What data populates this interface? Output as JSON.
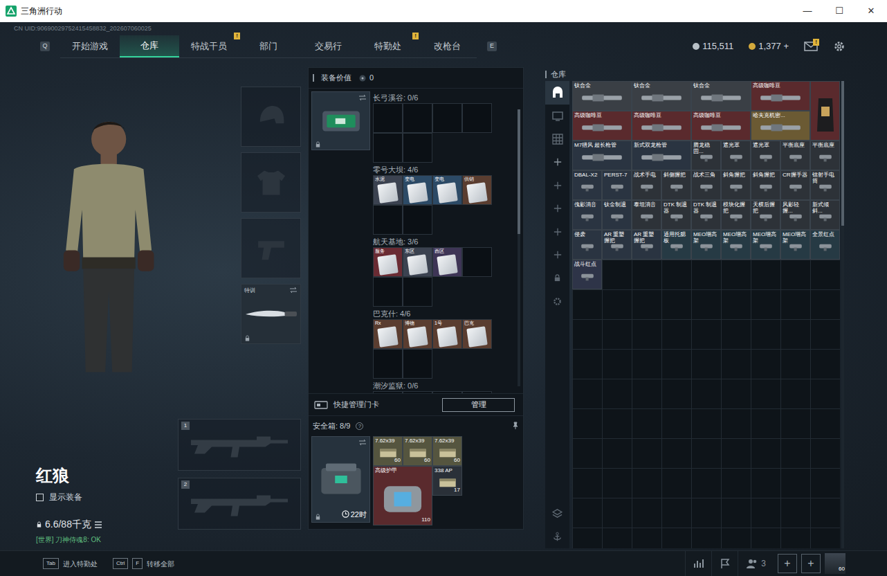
{
  "window": {
    "title": "三角洲行动",
    "controls": [
      "—",
      "☐",
      "✕"
    ]
  },
  "uid": "CN UID:90690029752415458832_202607060025",
  "nav": {
    "prev_key": "Q",
    "next_key": "E",
    "tabs": [
      {
        "label": "开始游戏",
        "selected": false
      },
      {
        "label": "仓库",
        "selected": true
      },
      {
        "label": "特战干员",
        "selected": false,
        "badge": "!"
      },
      {
        "label": "部门",
        "selected": false
      },
      {
        "label": "交易行",
        "selected": false
      },
      {
        "label": "特勤处",
        "selected": false,
        "badge": "!"
      },
      {
        "label": "改枪台",
        "selected": false
      }
    ]
  },
  "currency": [
    {
      "value": "115,511",
      "kind": "silver"
    },
    {
      "value": "1,377 +",
      "kind": "gold"
    }
  ],
  "mail": {
    "badge": "!"
  },
  "gear_slots": [
    {
      "kind": "helmet"
    },
    {
      "kind": "armor"
    },
    {
      "kind": "pistol"
    },
    {
      "kind": "melee",
      "label": "特训"
    }
  ],
  "weapon_slots": [
    "1",
    "2"
  ],
  "character": {
    "name": "红狼",
    "show_equipment": {
      "label": "显示装备",
      "checked": false
    },
    "weight": "6.6/88千克",
    "chat": "[世界] 刀神侍魂8: OK"
  },
  "equipment_value": {
    "label": "装备价值",
    "value": "0"
  },
  "keycards": {
    "scrollbar": {
      "level": 0.45
    },
    "sections": [
      {
        "title": "长弓溪谷: 0/6",
        "cards": []
      },
      {
        "title": "零号大坝: 4/6",
        "cards": [
          {
            "label": "水泥",
            "color": "#3b4250"
          },
          {
            "label": "变电",
            "color": "#2c4a66"
          },
          {
            "label": "变电",
            "color": "#2c4a66"
          },
          {
            "label": "供销",
            "color": "#5a3d30"
          }
        ]
      },
      {
        "title": "航天基地: 3/6",
        "cards": [
          {
            "label": "服务",
            "color": "#6a2b33"
          },
          {
            "label": "东区",
            "color": "#3b4250"
          },
          {
            "label": "西区",
            "color": "#3e3556"
          }
        ]
      },
      {
        "title": "巴克什: 4/6",
        "cards": [
          {
            "label": "Rx",
            "color": "#5a3d30"
          },
          {
            "label": "博物",
            "color": "#5a3d30"
          },
          {
            "label": "1号",
            "color": "#5a3d30"
          },
          {
            "label": "巴克",
            "color": "#5a3d30"
          }
        ]
      },
      {
        "title": "潮汐监狱: 0/6",
        "cards": []
      }
    ],
    "quick_manage": "快捷管理门卡",
    "manage_button": "管理"
  },
  "safe_box": {
    "title": "安全箱: 8/9",
    "help": "?",
    "timer": "22时",
    "items": [
      {
        "label": "7.62x39",
        "count": "60",
        "kind": "ammo",
        "color": "#55553f"
      },
      {
        "label": "7.62x39",
        "count": "60",
        "kind": "ammo",
        "color": "#55553f"
      },
      {
        "label": "7.62x39",
        "count": "60",
        "kind": "ammo",
        "color": "#55553f"
      },
      {
        "label": "高级护甲",
        "count": "110",
        "kind": "armor",
        "color": "#5a2a2d"
      },
      {
        "label": "338 AP",
        "count": "17",
        "kind": "ammo",
        "color": "#2a3038"
      }
    ]
  },
  "warehouse": {
    "title": "仓库",
    "scrollbar": {
      "level": 0.31
    },
    "sidebar": [
      {
        "kind": "warehouse",
        "selected": true
      },
      {
        "kind": "tv",
        "selected": false
      },
      {
        "kind": "grid",
        "selected": false
      },
      {
        "kind": "add",
        "selected": false
      },
      {
        "kind": "add",
        "selected": false
      },
      {
        "kind": "add",
        "selected": false
      },
      {
        "kind": "add",
        "selected": false
      },
      {
        "kind": "add",
        "selected": false
      },
      {
        "kind": "lock",
        "selected": false
      },
      {
        "kind": "settings",
        "selected": false
      }
    ],
    "footer_icons": [
      {
        "kind": "layers"
      },
      {
        "kind": "anchor"
      }
    ],
    "items": [
      {
        "label": "钛合金",
        "kind": "wide",
        "color": "#3a3f45"
      },
      {
        "label": "钛合金",
        "kind": "wide",
        "color": "#3a3f45"
      },
      {
        "label": "钛合金",
        "kind": "wide",
        "color": "#3a3f45"
      },
      {
        "label": "高级咖啡豆",
        "kind": "wide",
        "color": "#5a2a2d"
      },
      {
        "label": "",
        "kind": "tall",
        "color": "#5a2a2d"
      },
      {
        "label": "高级咖啡豆",
        "kind": "wide",
        "color": "#5a2a2d"
      },
      {
        "label": "高级咖啡豆",
        "kind": "wide",
        "color": "#5a2a2d"
      },
      {
        "label": "高级咖啡豆",
        "kind": "wide",
        "color": "#5a2a2d"
      },
      {
        "label": "哈夫克机密...",
        "kind": "wide",
        "color": "#6b5a33"
      },
      {
        "label": "M7猎风 超长枪管",
        "kind": "wide",
        "color": "#2a3441"
      },
      {
        "label": "新式双龙枪管",
        "kind": "wide",
        "color": "#2a3441"
      },
      {
        "label": "腾龙稳固...",
        "kind": "single",
        "color": "#2d3238"
      },
      {
        "label": "遮光罩",
        "kind": "single",
        "color": "#2d3238"
      },
      {
        "label": "遮光罩",
        "kind": "single",
        "color": "#2d3238"
      },
      {
        "label": "平衡底座",
        "kind": "single",
        "color": "#2d3238"
      },
      {
        "label": "平衡底座",
        "kind": "single",
        "color": "#2d3238"
      },
      {
        "label": "DBAL-X2",
        "kind": "single",
        "color": "#2a3441"
      },
      {
        "label": "PERST-7",
        "kind": "single",
        "color": "#2a3441"
      },
      {
        "label": "战术手电",
        "kind": "single",
        "color": "#2d3238"
      },
      {
        "label": "斜侧握把",
        "kind": "single",
        "color": "#2d3238"
      },
      {
        "label": "战术三角",
        "kind": "single",
        "color": "#2d3238"
      },
      {
        "label": "斜角握把",
        "kind": "single",
        "color": "#2d3238"
      },
      {
        "label": "斜角握把",
        "kind": "single",
        "color": "#2d3238"
      },
      {
        "label": "CR握手器",
        "kind": "single",
        "color": "#2d3238"
      },
      {
        "label": "镭射手电筒",
        "kind": "single",
        "color": "#2d3238"
      },
      {
        "label": "傀影消音",
        "kind": "single",
        "color": "#2a3441"
      },
      {
        "label": "钛金制退",
        "kind": "single",
        "color": "#2a3441"
      },
      {
        "label": "泰坦消音",
        "kind": "single",
        "color": "#2d3238"
      },
      {
        "label": "DTK 制退器",
        "kind": "single",
        "color": "#2d3238"
      },
      {
        "label": "DTK 制退器",
        "kind": "single",
        "color": "#2d3238"
      },
      {
        "label": "模块化握把",
        "kind": "single",
        "color": "#2d3238"
      },
      {
        "label": "天横后握把",
        "kind": "single",
        "color": "#2d3238"
      },
      {
        "label": "风影轻握...",
        "kind": "single",
        "color": "#2d3238"
      },
      {
        "label": "新式倾斜...",
        "kind": "single",
        "color": "#2d3238"
      },
      {
        "label": "侵袭",
        "kind": "single",
        "color": "#2a3441"
      },
      {
        "label": "AR 重塑握把",
        "kind": "single",
        "color": "#2a3441"
      },
      {
        "label": "AR 重塑握把",
        "kind": "single",
        "color": "#2a3441"
      },
      {
        "label": "通用托腮板",
        "kind": "single",
        "color": "#263a44"
      },
      {
        "label": "MEO增高架",
        "kind": "single",
        "color": "#263a44"
      },
      {
        "label": "MEO增高架",
        "kind": "single",
        "color": "#263a44"
      },
      {
        "label": "MEO增高架",
        "kind": "single",
        "color": "#263a44"
      },
      {
        "label": "MEO增高架",
        "kind": "single",
        "color": "#263a44"
      },
      {
        "label": "全景红点",
        "kind": "single",
        "color": "#263a44"
      },
      {
        "label": "战斗红点",
        "kind": "single",
        "color": "#2e3448"
      }
    ]
  },
  "hotkeys": [
    {
      "keys": [
        "Tab"
      ],
      "label": "进入特勤处"
    },
    {
      "keys": [
        "Ctrl",
        "F"
      ],
      "label": "转移全部"
    }
  ],
  "social": {
    "friends": "3",
    "add_buttons": [
      "+",
      "+"
    ],
    "avatar_level": "60"
  }
}
